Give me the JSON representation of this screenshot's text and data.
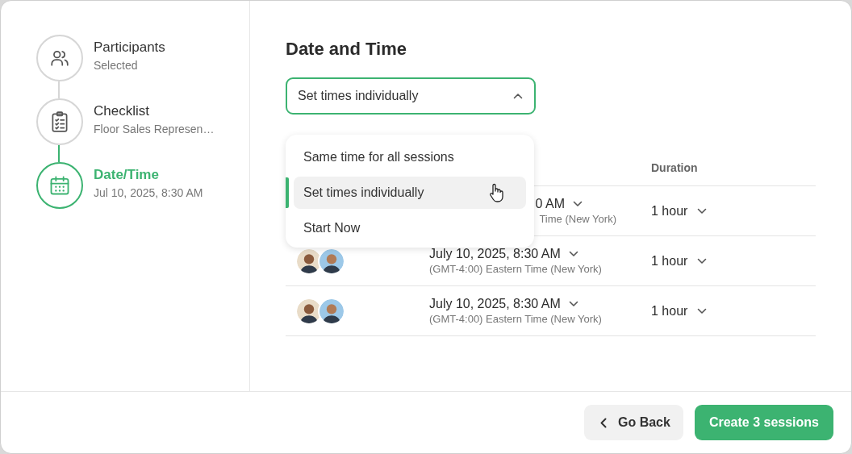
{
  "steps": [
    {
      "title": "Participants",
      "subtitle": "Selected",
      "selected": false
    },
    {
      "title": "Checklist",
      "subtitle": "Floor Sales Represen…",
      "selected": false
    },
    {
      "title": "Date/Time",
      "subtitle": "Jul 10, 2025, 8:30 AM",
      "selected": true
    }
  ],
  "heading": "Date and Time",
  "schedule_select": {
    "value": "Set times individually",
    "expanded": true
  },
  "menu": [
    {
      "label": "Same time for all sessions",
      "selected": false
    },
    {
      "label": "Set times individually",
      "selected": true
    },
    {
      "label": "Start Now",
      "selected": false
    }
  ],
  "table": {
    "columns": [
      {
        "label": "Duration"
      }
    ],
    "rows": [
      {
        "covered": true,
        "date": "0 AM",
        "timezone": "Time (New York)",
        "duration": "1 hour"
      },
      {
        "covered": false,
        "date": "July 10, 2025, 8:30 AM",
        "timezone": "(GMT-4:00) Eastern Time (New York)",
        "duration": "1 hour"
      },
      {
        "covered": false,
        "date": "July 10, 2025, 8:30 AM",
        "timezone": "(GMT-4:00) Eastern Time (New York)",
        "duration": "1 hour"
      }
    ]
  },
  "buttons": [
    {
      "label": "Go Back",
      "kind": "secondary"
    },
    {
      "label": "Create 3 sessions",
      "kind": "primary"
    }
  ]
}
